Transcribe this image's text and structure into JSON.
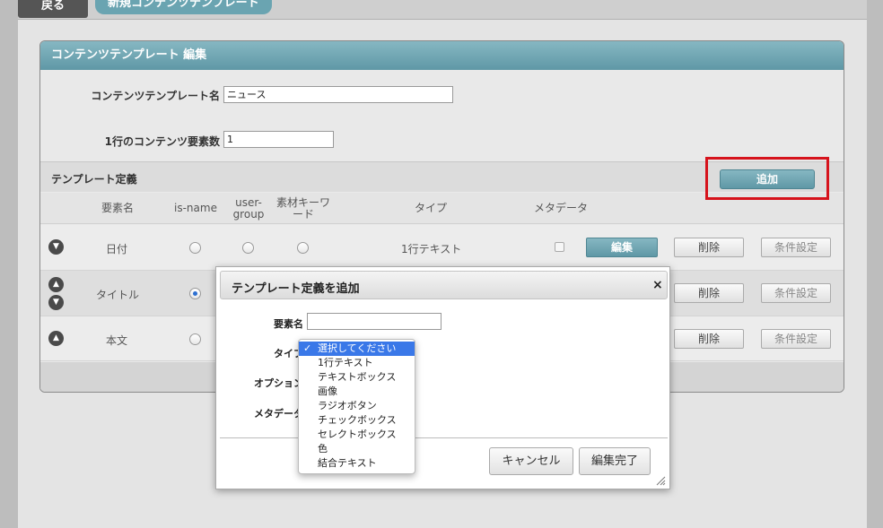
{
  "nav": {
    "back_label": "戻る",
    "breadcrumb": "新規コンテンツテンプレート"
  },
  "panel": {
    "title": "コンテンツテンプレート 編集",
    "template_name_label": "コンテンツテンプレート名",
    "template_name_value": "ニュース",
    "elements_per_row_label": "1行のコンテンツ要素数",
    "elements_per_row_value": "1",
    "definitions_title": "テンプレート定義",
    "add_button": "追加"
  },
  "table": {
    "headers": {
      "name": "要素名",
      "is_name": "is-name",
      "user_group_1": "user-",
      "user_group_2": "group",
      "keyword_1": "素材キーワ",
      "keyword_2": "ード",
      "type": "タイプ",
      "metadata": "メタデータ"
    },
    "rows": [
      {
        "name": "日付",
        "type": "1行テキスト",
        "is_name": false,
        "edit": "編集",
        "delete": "削除",
        "condition": "条件設定"
      },
      {
        "name": "タイトル",
        "is_name": true,
        "delete": "削除",
        "condition": "条件設定"
      },
      {
        "name": "本文",
        "is_name": false,
        "delete": "削除",
        "condition": "条件設定"
      }
    ]
  },
  "dialog": {
    "title": "テンプレート定義を追加",
    "close_icon": "×",
    "element_name_label": "要素名",
    "element_name_value": "",
    "type_label": "タイプ",
    "option_label": "オプション",
    "metadata_label": "メタデータ",
    "cancel_button": "キャンセル",
    "done_button": "編集完了"
  },
  "type_dropdown": {
    "selected_index": 0,
    "options": [
      "選択してください",
      "1行テキスト",
      "テキストボックス",
      "画像",
      "ラジオボタン",
      "チェックボックス",
      "セレクトボックス",
      "色",
      "結合テキスト"
    ]
  },
  "colors": {
    "accent": "#6aa4b1",
    "highlight": "#d6131c",
    "selection": "#3a78e8"
  }
}
